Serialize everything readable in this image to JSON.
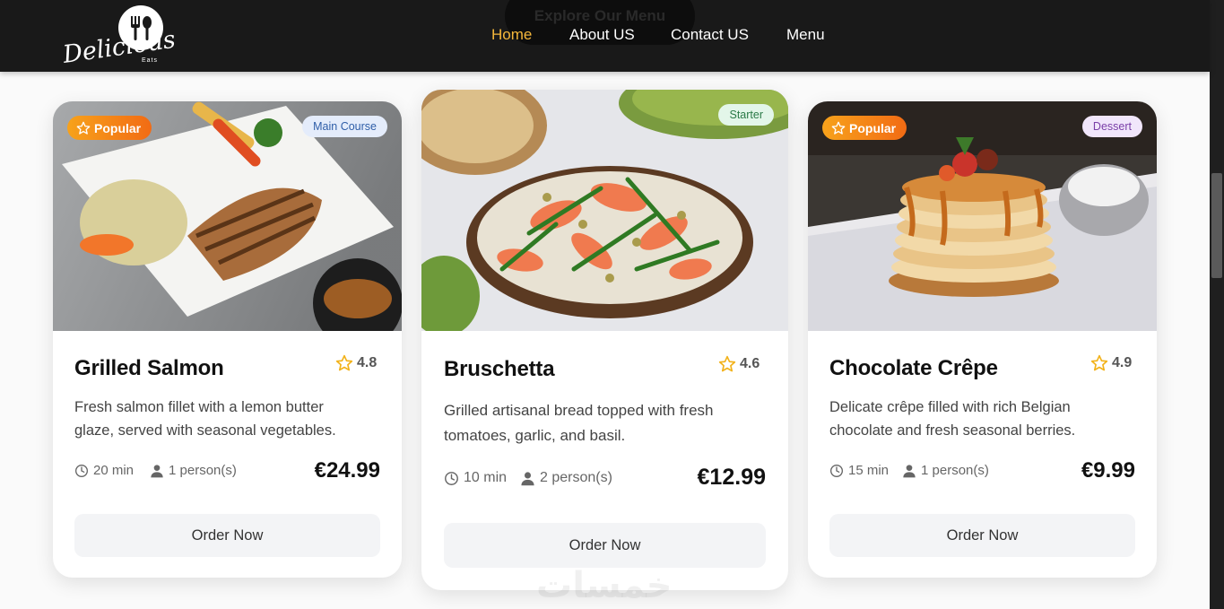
{
  "header": {
    "explore_button": "Explore Our Menu",
    "logo": {
      "name": "Delicious",
      "sub": "Eats"
    },
    "nav": [
      {
        "label": "Home",
        "active": true
      },
      {
        "label": "About US"
      },
      {
        "label": "Contact US"
      },
      {
        "label": "Menu"
      }
    ],
    "accent_color": "#f5b73b"
  },
  "cards": [
    {
      "popular_label": "Popular",
      "category": "Main Course",
      "category_bg": "#e4ecfb",
      "category_color": "#2f5ea8",
      "title": "Grilled Salmon",
      "rating": "4.8",
      "description_line1": "Fresh salmon fillet with a lemon butter",
      "description_line2": "glaze, served with seasonal vegetables.",
      "time": "20 min",
      "persons": "1 person(s)",
      "price": "€24.99",
      "button": "Order Now",
      "image_icon": "grilled-salmon-plate"
    },
    {
      "category": "Starter",
      "category_bg": "#e3f6e9",
      "category_color": "#2b7a47",
      "title": "Bruschetta",
      "rating": "4.6",
      "description_line1": "Grilled artisanal bread topped with fresh",
      "description_line2": "tomatoes, garlic, and basil.",
      "time": "10 min",
      "persons": "2 person(s)",
      "price": "€12.99",
      "button": "Order Now",
      "image_icon": "bruschetta-toast"
    },
    {
      "popular_label": "Popular",
      "category": "Dessert",
      "category_bg": "#f1e6fb",
      "category_color": "#7a3fa8",
      "title": "Chocolate Crêpe",
      "rating": "4.9",
      "description_line1": "Delicate crêpe filled with rich Belgian",
      "description_line2": "chocolate and fresh seasonal berries.",
      "time": "15 min",
      "persons": "1 person(s)",
      "price": "€9.99",
      "button": "Order Now",
      "image_icon": "pancake-stack"
    }
  ],
  "watermark": "خمسات"
}
